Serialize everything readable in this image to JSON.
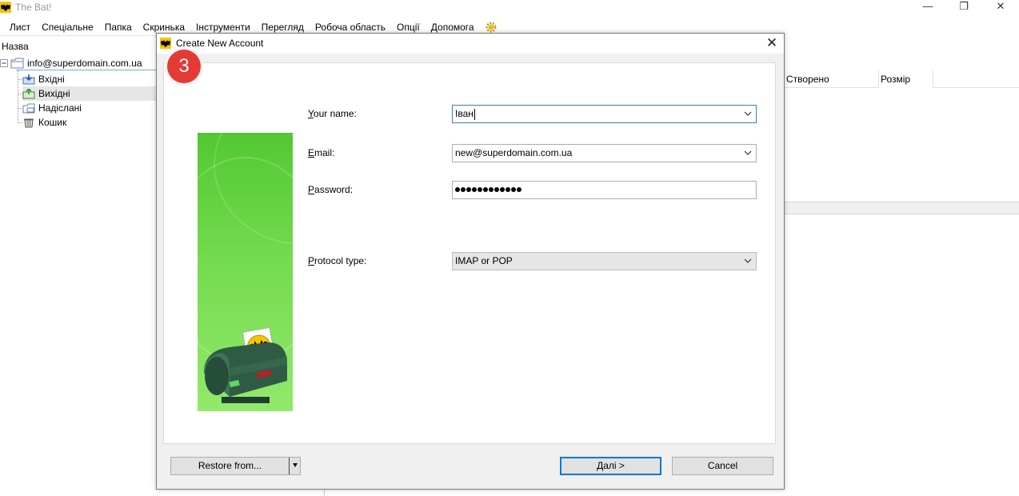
{
  "app": {
    "title": "The Bat!",
    "controls": {
      "minimize": "—",
      "maximize": "❐",
      "close": "✕"
    }
  },
  "menu": [
    "Лист",
    "Спеціальне",
    "Папка",
    "Скринька",
    "Інструменти",
    "Перегляд",
    "Робоча область",
    "Опції",
    "Допомога"
  ],
  "tree": {
    "header": "Назва",
    "account": "info@superdomain.com.ua",
    "folders": [
      {
        "label": "Вхідні",
        "icon": "inbox-icon"
      },
      {
        "label": "Вихідні",
        "icon": "outbox-icon",
        "selected": true
      },
      {
        "label": "Надіслані",
        "icon": "sent-icon"
      },
      {
        "label": "Кошик",
        "icon": "trash-icon"
      }
    ]
  },
  "message_list": {
    "columns": [
      "Створено",
      "Розмір"
    ]
  },
  "dialog": {
    "title": "Create New Account",
    "close_glyph": "✕",
    "step": "3",
    "fields": {
      "name": {
        "label_prefix": "",
        "label_ul": "Y",
        "label_rest": "our name:",
        "value": "Іван"
      },
      "email": {
        "label_ul": "E",
        "label_rest": "mail:",
        "value": "new@superdomain.com.ua"
      },
      "password": {
        "label_ul": "P",
        "label_rest": "assword:",
        "dots": 12
      },
      "protocol": {
        "label_ul": "P",
        "label_rest": "rotocol type:",
        "value": "IMAP or POP"
      }
    },
    "buttons": {
      "restore": "Restore from...",
      "next": "Далі  >",
      "cancel": "Cancel"
    }
  },
  "colors": {
    "badge": "#e53935",
    "banner": "#6fd84a",
    "focus_border": "#3c7fb1",
    "default_button": "#0078d7"
  }
}
